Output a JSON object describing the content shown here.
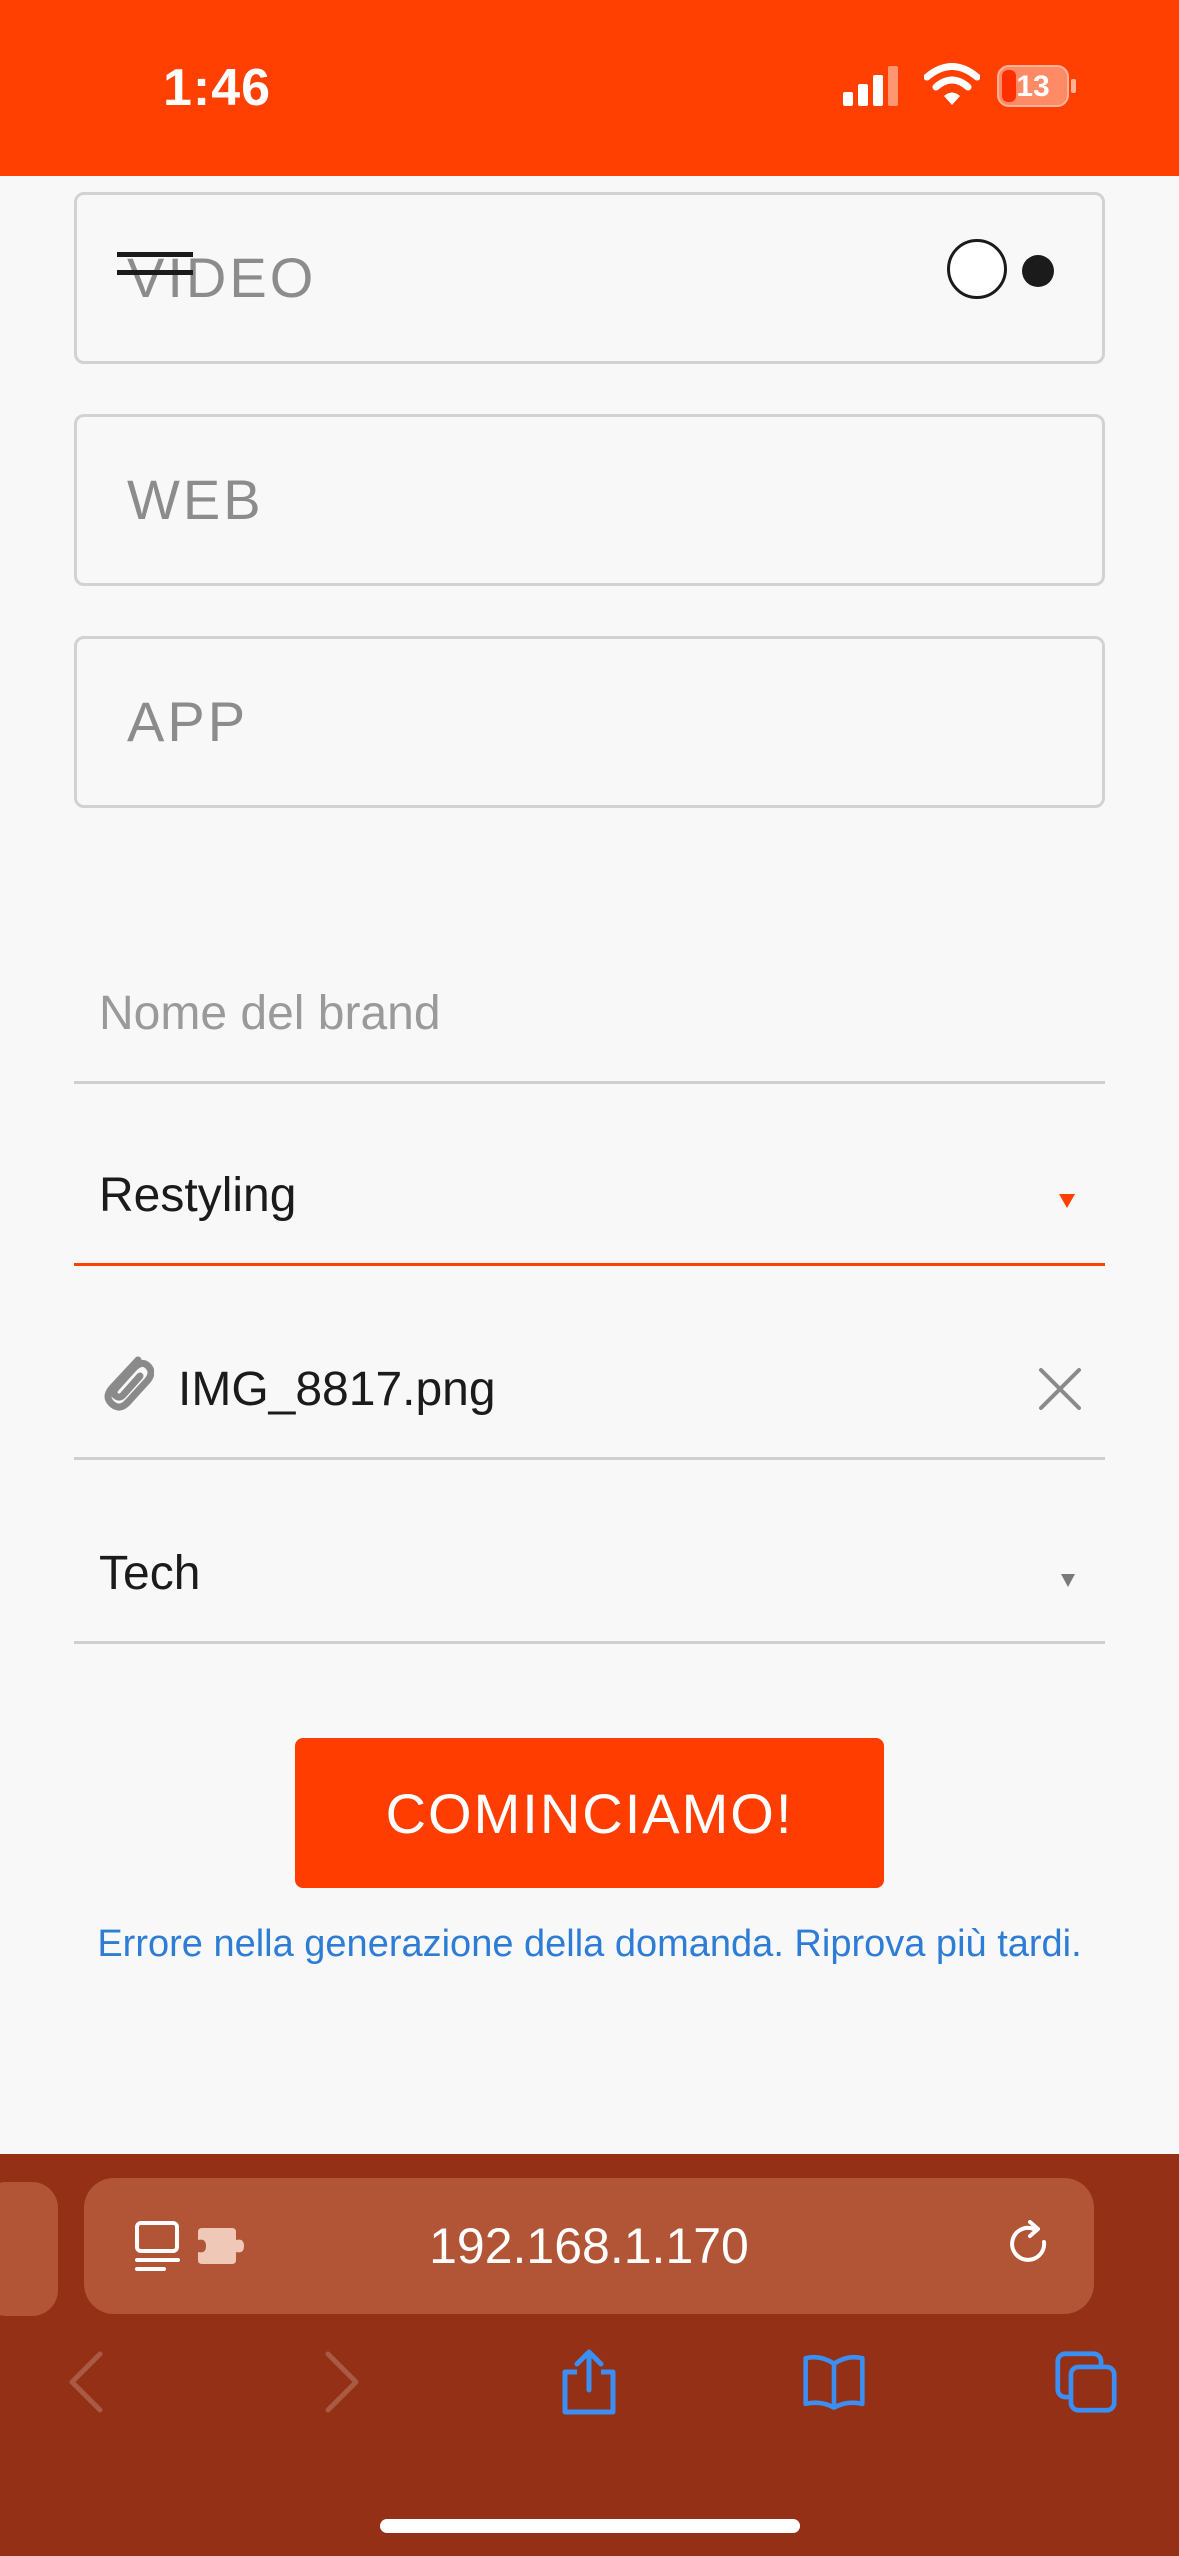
{
  "status_bar": {
    "time": "1:46",
    "battery_level": "13",
    "background_color": "#ff4000"
  },
  "options": [
    {
      "label": "VIDEO"
    },
    {
      "label": "WEB"
    },
    {
      "label": "APP"
    }
  ],
  "form": {
    "brand_name_placeholder": "Nome del brand",
    "service_select_value": "Restyling",
    "attachment_filename": "IMG_8817.png",
    "sector_select_value": "Tech",
    "submit_label": "COMINCIAMO!",
    "error_message": "Errore nella generazione della domanda. Riprova più tardi."
  },
  "browser": {
    "url": "192.168.1.170"
  },
  "colors": {
    "accent": "#ff4000",
    "error_text": "#2d7cd6",
    "browser_bar": "#943016"
  },
  "icons": [
    "menu-icon",
    "toggle-icon",
    "paperclip-icon",
    "close-icon",
    "reader-icon",
    "extension-icon",
    "reload-icon",
    "back-icon",
    "forward-icon",
    "share-icon",
    "bookmarks-icon",
    "tabs-icon"
  ]
}
